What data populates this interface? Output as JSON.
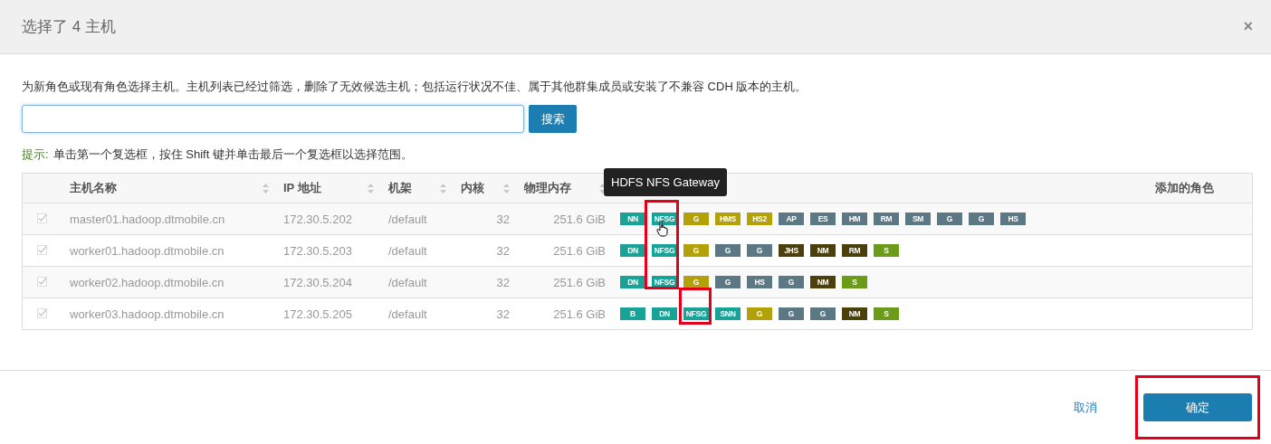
{
  "dialog": {
    "title": "选择了 4 主机",
    "close": "×"
  },
  "description": "为新角色或现有角色选择主机。主机列表已经过筛选，删除了无效候选主机；包括运行状况不佳、属于其他群集成员或安装了不兼容 CDH 版本的主机。",
  "search": {
    "button": "搜索"
  },
  "hint": {
    "label": "提示:",
    "text": "单击第一个复选框，按住 Shift 键并单击最后一个复选框以选择范围。"
  },
  "table": {
    "columns": [
      {
        "label": "主机名称",
        "sortable": true
      },
      {
        "label": "IP 地址",
        "sortable": true
      },
      {
        "label": "机架",
        "sortable": true
      },
      {
        "label": "内核",
        "sortable": true
      },
      {
        "label": "物理内存",
        "sortable": true
      },
      {
        "sortable": false
      },
      {
        "label": "添加的角色",
        "sortable": false
      }
    ],
    "rows": [
      {
        "checked": true,
        "name": "master01.hadoop.dtmobile.cn",
        "ip": "172.30.5.202",
        "rack": "/default",
        "cores": "32",
        "memory": "251.6 GiB",
        "roles": [
          {
            "label": "NN",
            "color": "#17a398"
          },
          {
            "label": "NFSG",
            "color": "#17a398"
          },
          {
            "label": "G",
            "color": "#b3a10a"
          },
          {
            "label": "HMS",
            "color": "#b3a10a"
          },
          {
            "label": "HS2",
            "color": "#b3a10a"
          },
          {
            "label": "AP",
            "color": "#5d7885"
          },
          {
            "label": "ES",
            "color": "#5d7885"
          },
          {
            "label": "HM",
            "color": "#5d7885"
          },
          {
            "label": "RM",
            "color": "#5d7885"
          },
          {
            "label": "SM",
            "color": "#5d7885"
          },
          {
            "label": "G",
            "color": "#5d7885"
          },
          {
            "label": "G",
            "color": "#5d7885"
          },
          {
            "label": "HS",
            "color": "#5d7885"
          }
        ]
      },
      {
        "checked": true,
        "name": "worker01.hadoop.dtmobile.cn",
        "ip": "172.30.5.203",
        "rack": "/default",
        "cores": "32",
        "memory": "251.6 GiB",
        "roles": [
          {
            "label": "DN",
            "color": "#17a398"
          },
          {
            "label": "NFSG",
            "color": "#17a398"
          },
          {
            "label": "G",
            "color": "#b3a10a"
          },
          {
            "label": "G",
            "color": "#5d7885"
          },
          {
            "label": "G",
            "color": "#5d7885"
          },
          {
            "label": "JHS",
            "color": "#4b400c"
          },
          {
            "label": "NM",
            "color": "#4b400c"
          },
          {
            "label": "RM",
            "color": "#4b400c"
          },
          {
            "label": "S",
            "color": "#6b9c19"
          }
        ]
      },
      {
        "checked": true,
        "name": "worker02.hadoop.dtmobile.cn",
        "ip": "172.30.5.204",
        "rack": "/default",
        "cores": "32",
        "memory": "251.6 GiB",
        "roles": [
          {
            "label": "DN",
            "color": "#17a398"
          },
          {
            "label": "NFSG",
            "color": "#17a398"
          },
          {
            "label": "G",
            "color": "#b3a10a"
          },
          {
            "label": "G",
            "color": "#5d7885"
          },
          {
            "label": "HS",
            "color": "#5d7885"
          },
          {
            "label": "G",
            "color": "#5d7885"
          },
          {
            "label": "NM",
            "color": "#4b400c"
          },
          {
            "label": "S",
            "color": "#6b9c19"
          }
        ]
      },
      {
        "checked": true,
        "name": "worker03.hadoop.dtmobile.cn",
        "ip": "172.30.5.205",
        "rack": "/default",
        "cores": "32",
        "memory": "251.6 GiB",
        "roles": [
          {
            "label": "B",
            "color": "#17a398"
          },
          {
            "label": "DN",
            "color": "#17a398"
          },
          {
            "label": "NFSG",
            "color": "#17a398"
          },
          {
            "label": "SNN",
            "color": "#17a398"
          },
          {
            "label": "G",
            "color": "#b3a10a"
          },
          {
            "label": "G",
            "color": "#5d7885"
          },
          {
            "label": "G",
            "color": "#5d7885"
          },
          {
            "label": "NM",
            "color": "#4b400c"
          },
          {
            "label": "S",
            "color": "#6b9c19"
          }
        ]
      }
    ]
  },
  "tooltip": "HDFS NFS Gateway",
  "footer": {
    "cancel": "取消",
    "confirm": "确定"
  }
}
